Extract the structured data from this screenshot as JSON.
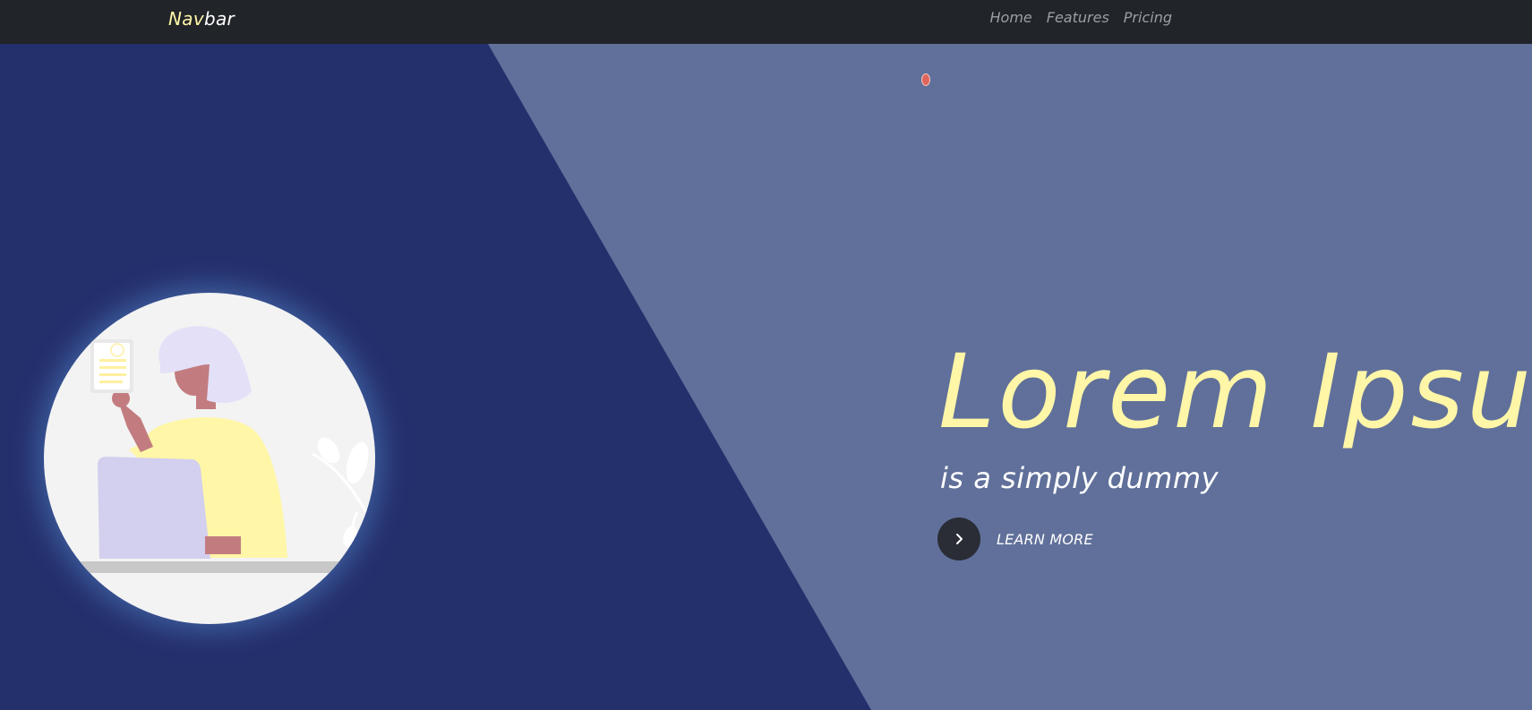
{
  "navbar": {
    "brand_part1": "Nav",
    "brand_part2": "bar",
    "links": [
      "Home",
      "Features",
      "Pricing"
    ]
  },
  "hero": {
    "headline": "Lorem Ipsum",
    "subheadline": "is a simply dummy",
    "cta_label": "LEARN MORE",
    "cta_icon": "chevron-right-icon",
    "illustration": "person-with-laptop-and-document-illustration"
  },
  "colors": {
    "navbar_bg": "#212428",
    "hero_dark": "#24306c",
    "hero_light": "#60709a",
    "accent_yellow": "#fff6a8",
    "cta_circle": "#2a2c36"
  }
}
